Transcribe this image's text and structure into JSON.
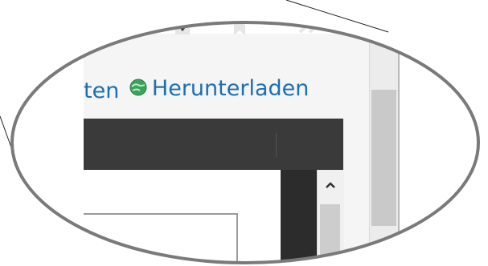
{
  "links": {
    "partial_label": "ten",
    "download_label": "Herunterladen"
  },
  "toolbar": {
    "icons": [
      "printer-icon",
      "download-document-icon",
      "bookmark-icon",
      "double-chevron-right-icon"
    ]
  },
  "scrollbar": {
    "up_arrow": "^"
  },
  "colors": {
    "link": "#1a6fb5",
    "toolbar": "#3a3a3a",
    "icon": "#e6e6e6",
    "globe": "#3aa35a"
  }
}
